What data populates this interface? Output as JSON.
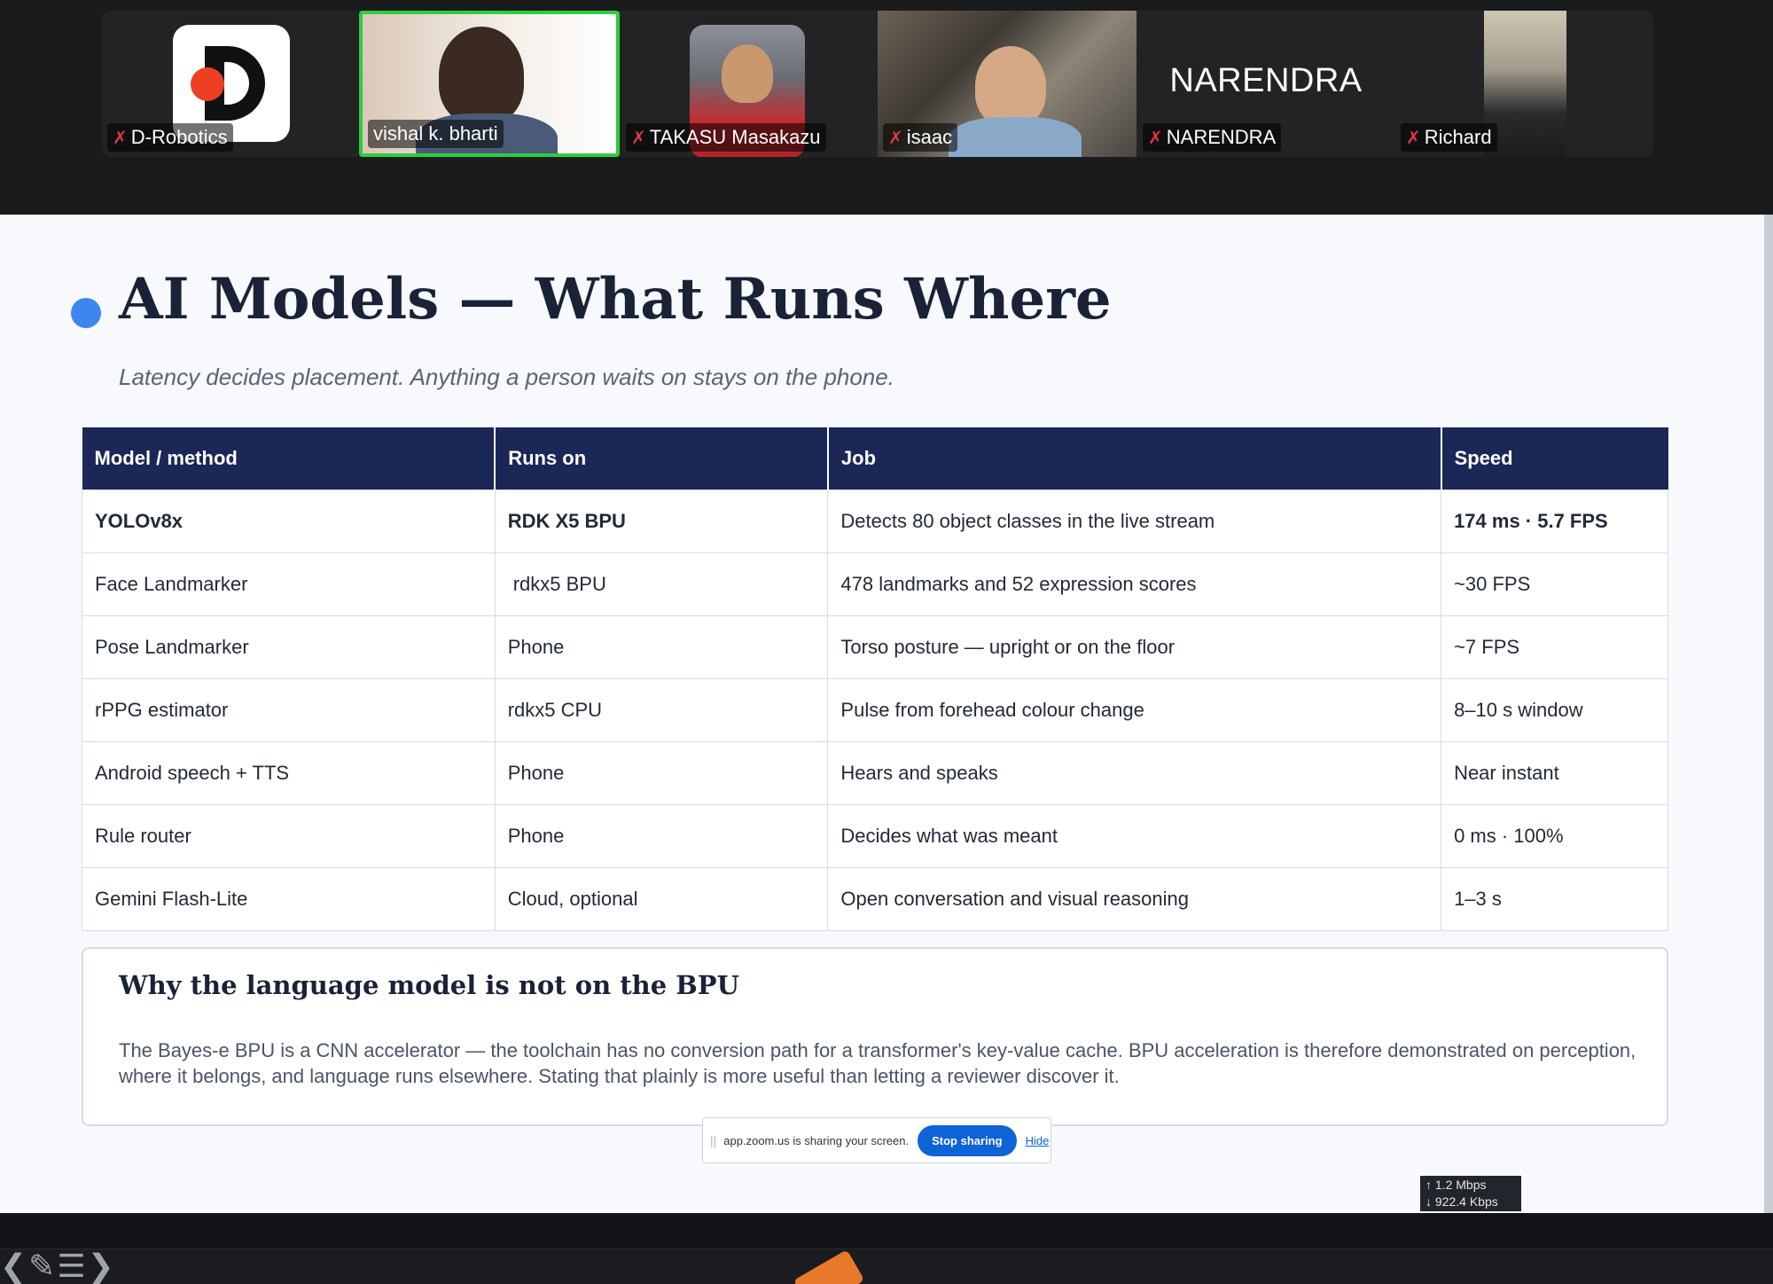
{
  "participants": [
    {
      "name": "D-Robotics",
      "muted": true
    },
    {
      "name": "vishal k. bharti",
      "muted": false,
      "active_speaker": true
    },
    {
      "name": "TAKASU Masakazu",
      "muted": true
    },
    {
      "name": "isaac",
      "muted": true
    },
    {
      "name": "NARENDRA",
      "muted": true,
      "display_text": "NARENDRA"
    },
    {
      "name": "Richard",
      "muted": true
    }
  ],
  "slide": {
    "title": "AI Models — What Runs Where",
    "subtitle": "Latency decides placement. Anything a person waits on stays on the phone.",
    "table": {
      "headers": [
        "Model / method",
        "Runs on",
        "Job",
        "Speed"
      ],
      "rows": [
        [
          "YOLOv8x",
          "RDK X5 BPU",
          "Detects 80 object classes in the live stream",
          "174 ms · 5.7 FPS"
        ],
        [
          "Face Landmarker",
          "rdkx5 BPU",
          "478 landmarks and 52 expression scores",
          "~30 FPS"
        ],
        [
          "Pose Landmarker",
          "Phone",
          "Torso posture — upright or on the floor",
          "~7 FPS"
        ],
        [
          "rPPG estimator",
          "rdkx5 CPU",
          "Pulse from forehead colour change",
          "8–10 s window"
        ],
        [
          "Android speech + TTS",
          "Phone",
          "Hears and speaks",
          "Near instant"
        ],
        [
          "Rule router",
          "Phone",
          "Decides what was meant",
          "0 ms · 100%"
        ],
        [
          "Gemini Flash-Lite",
          "Cloud, optional",
          "Open conversation and visual reasoning",
          "1–3 s"
        ]
      ]
    },
    "why": {
      "heading": "Why the language model is not on the BPU",
      "body": "The Bayes-e BPU is a CNN accelerator — the toolchain has no conversion path for a transformer's key-value cache. BPU acceleration is therefore demonstrated on perception, where it belongs, and language runs elsewhere. Stating that plainly is more useful than letting a reviewer discover it."
    }
  },
  "share_bar": {
    "message": "app.zoom.us is sharing your screen.",
    "stop_label": "Stop sharing",
    "hide_label": "Hide"
  },
  "network": {
    "upload": "↑ 1.2 Mbps",
    "download": "↓ 922.4 Kbps"
  },
  "colors": {
    "header_bg": "#1b2756",
    "accent_dot": "#3d85f0",
    "bpu_green": "#1a7a5c",
    "speaker_border": "#2ecc40",
    "muted_red": "#e0393e"
  }
}
